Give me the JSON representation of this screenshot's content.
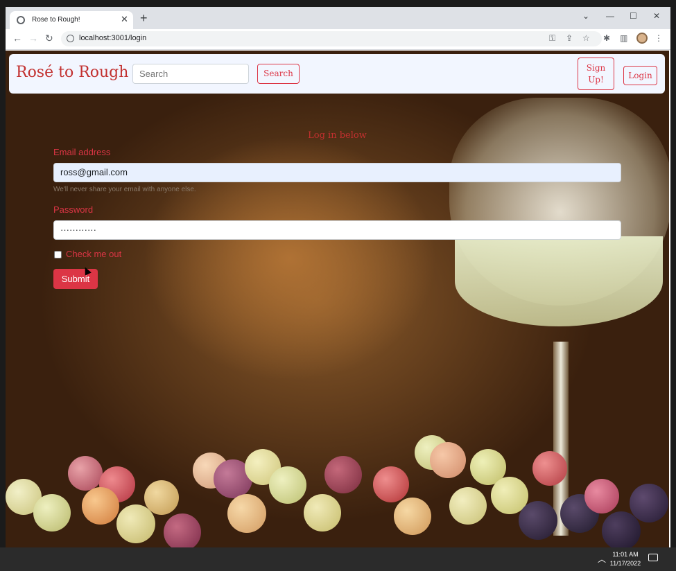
{
  "browser": {
    "tab_title": "Rose to Rough!",
    "tab_close": "✕",
    "new_tab": "+",
    "url": "localhost:3001/login",
    "minimize": "—",
    "maximize": "☐",
    "close": "✕",
    "chevron": "⌄"
  },
  "navbar": {
    "brand": "Rosé to Rough",
    "search_placeholder": "Search",
    "search_button": "Search",
    "signup_button": "Sign Up!",
    "login_button": "Login"
  },
  "form": {
    "heading": "Log in below",
    "email_label": "Email address",
    "email_value": "ross@gmail.com",
    "email_help": "We'll never share your email with anyone else.",
    "password_label": "Password",
    "password_value": "············",
    "checkbox_label": "Check me out",
    "submit_label": "Submit"
  },
  "taskbar": {
    "time": "11:01 AM",
    "date": "11/17/2022",
    "tray_chevron": "︿"
  },
  "colors": {
    "accent": "#dc3545",
    "brand": "#c2302f",
    "navbar_bg": "#f2f6ff"
  }
}
